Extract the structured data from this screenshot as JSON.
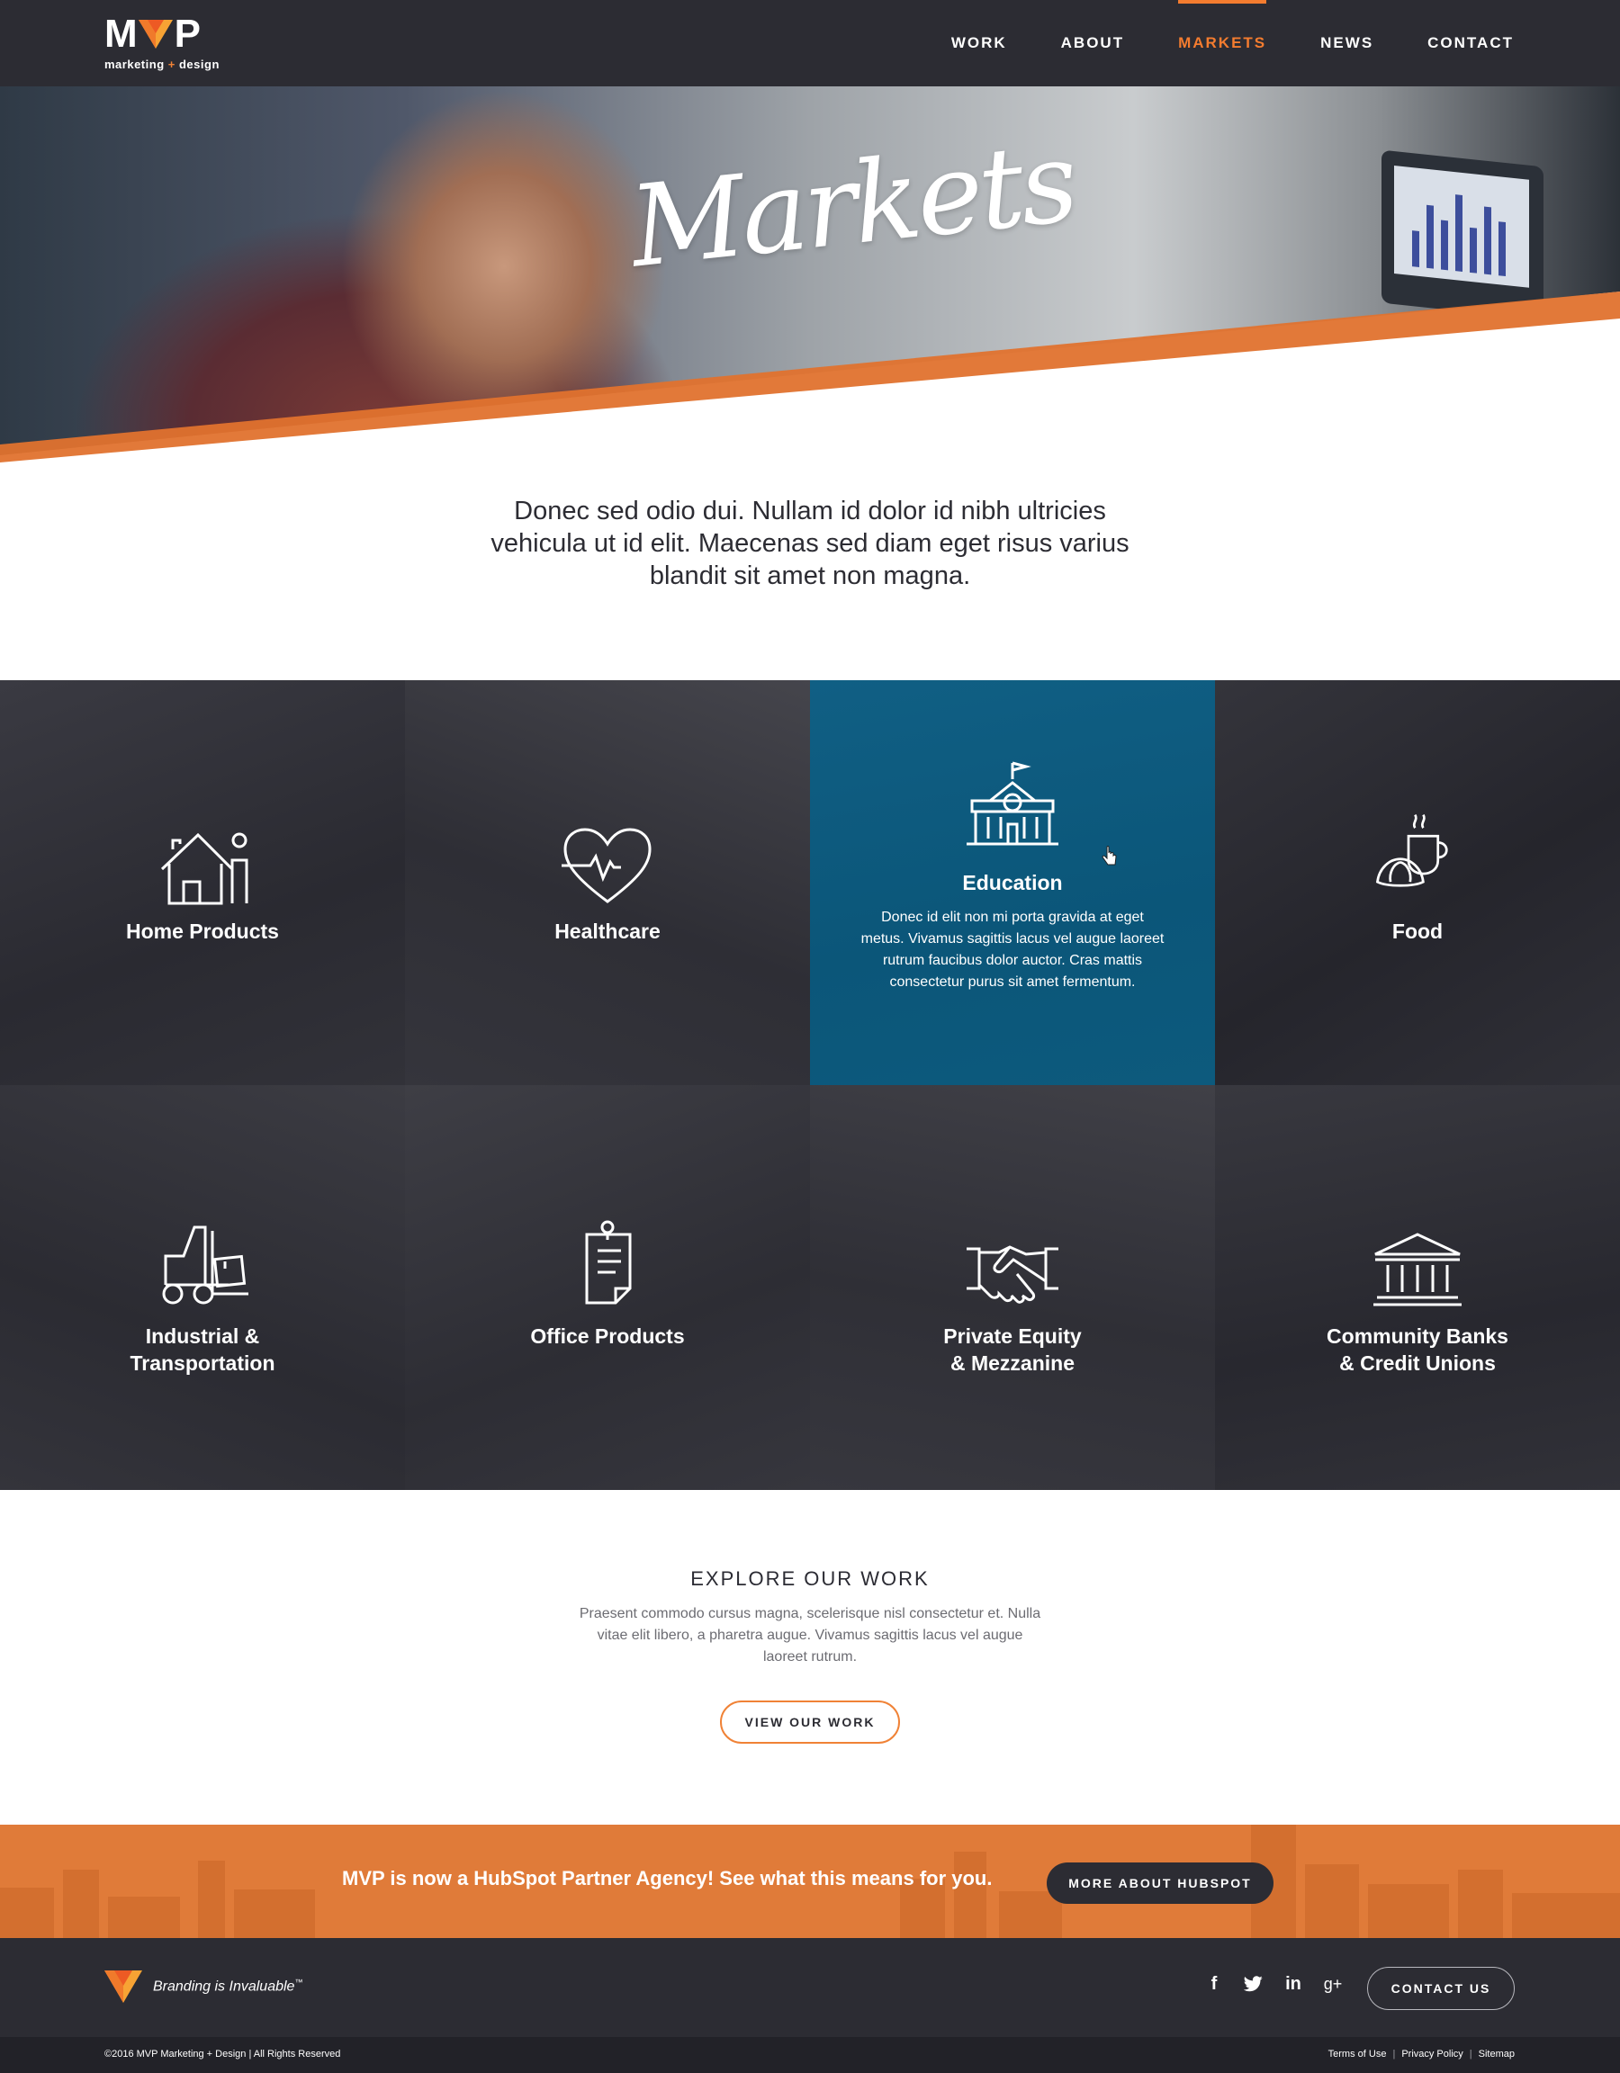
{
  "header": {
    "logo": {
      "text_left": "M",
      "text_right": "P",
      "subtitle_a": "marketing",
      "subtitle_plus": "+",
      "subtitle_b": "design"
    },
    "nav": [
      {
        "label": "WORK",
        "active": false
      },
      {
        "label": "ABOUT",
        "active": false
      },
      {
        "label": "MARKETS",
        "active": true
      },
      {
        "label": "NEWS",
        "active": false
      },
      {
        "label": "CONTACT",
        "active": false
      }
    ]
  },
  "hero": {
    "title": "Markets"
  },
  "intro": {
    "text": "Donec sed odio dui. Nullam id dolor id nibh ultricies vehicula ut id elit. Maecenas sed diam eget risus varius blandit sit amet non magna."
  },
  "markets": [
    {
      "label": "Home Products",
      "icon": "house-person-icon"
    },
    {
      "label": "Healthcare",
      "icon": "heart-pulse-icon"
    },
    {
      "label": "Education",
      "icon": "school-building-icon",
      "highlighted": true,
      "description": "Donec id elit non mi porta gravida at eget metus. Vivamus sagittis lacus vel augue laoreet rutrum faucibus dolor auctor. Cras mattis consectetur purus sit amet fermentum."
    },
    {
      "label": "Food",
      "icon": "croissant-coffee-icon"
    },
    {
      "label_line1": "Industrial &",
      "label_line2": "Transportation",
      "icon": "forklift-icon"
    },
    {
      "label": "Office Products",
      "icon": "clipboard-icon"
    },
    {
      "label_line1": "Private Equity",
      "label_line2": "& Mezzanine",
      "icon": "handshake-icon"
    },
    {
      "label_line1": "Community Banks",
      "label_line2": "& Credit Unions",
      "icon": "bank-icon"
    }
  ],
  "explore": {
    "heading": "EXPLORE OUR WORK",
    "text": "Praesent commodo cursus magna, scelerisque nisl consectetur et. Nulla vitae elit libero, a pharetra augue. Vivamus sagittis lacus vel augue laoreet rutrum.",
    "button": "VIEW OUR WORK"
  },
  "banner": {
    "text": "MVP is now a HubSpot Partner Agency! See what this means for you.",
    "button": "MORE ABOUT HUBSPOT"
  },
  "footer": {
    "tagline": "Branding is Invaluable",
    "tagline_mark": "™",
    "social": [
      "f",
      "twitter-icon",
      "in",
      "g+"
    ],
    "contact_button": "CONTACT US",
    "copyright": "©2016 MVP Marketing + Design | All Rights Reserved",
    "legal": [
      "Terms of Use",
      "Privacy Policy",
      "Sitemap"
    ]
  },
  "colors": {
    "accent": "#f47c2f",
    "dark": "#2c2c33",
    "education_blue": "#0e5a7e",
    "banner": "#e07b39"
  }
}
